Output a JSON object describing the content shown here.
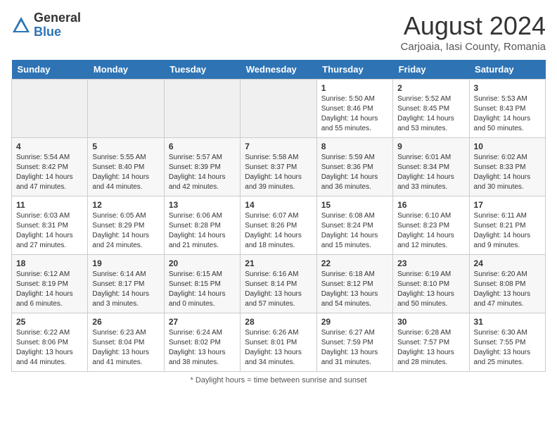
{
  "header": {
    "logo_line1": "General",
    "logo_line2": "Blue",
    "month_title": "August 2024",
    "subtitle": "Carjoaia, Iasi County, Romania"
  },
  "days_of_week": [
    "Sunday",
    "Monday",
    "Tuesday",
    "Wednesday",
    "Thursday",
    "Friday",
    "Saturday"
  ],
  "weeks": [
    [
      {
        "day": "",
        "info": ""
      },
      {
        "day": "",
        "info": ""
      },
      {
        "day": "",
        "info": ""
      },
      {
        "day": "",
        "info": ""
      },
      {
        "day": "1",
        "info": "Sunrise: 5:50 AM\nSunset: 8:46 PM\nDaylight: 14 hours\nand 55 minutes."
      },
      {
        "day": "2",
        "info": "Sunrise: 5:52 AM\nSunset: 8:45 PM\nDaylight: 14 hours\nand 53 minutes."
      },
      {
        "day": "3",
        "info": "Sunrise: 5:53 AM\nSunset: 8:43 PM\nDaylight: 14 hours\nand 50 minutes."
      }
    ],
    [
      {
        "day": "4",
        "info": "Sunrise: 5:54 AM\nSunset: 8:42 PM\nDaylight: 14 hours\nand 47 minutes."
      },
      {
        "day": "5",
        "info": "Sunrise: 5:55 AM\nSunset: 8:40 PM\nDaylight: 14 hours\nand 44 minutes."
      },
      {
        "day": "6",
        "info": "Sunrise: 5:57 AM\nSunset: 8:39 PM\nDaylight: 14 hours\nand 42 minutes."
      },
      {
        "day": "7",
        "info": "Sunrise: 5:58 AM\nSunset: 8:37 PM\nDaylight: 14 hours\nand 39 minutes."
      },
      {
        "day": "8",
        "info": "Sunrise: 5:59 AM\nSunset: 8:36 PM\nDaylight: 14 hours\nand 36 minutes."
      },
      {
        "day": "9",
        "info": "Sunrise: 6:01 AM\nSunset: 8:34 PM\nDaylight: 14 hours\nand 33 minutes."
      },
      {
        "day": "10",
        "info": "Sunrise: 6:02 AM\nSunset: 8:33 PM\nDaylight: 14 hours\nand 30 minutes."
      }
    ],
    [
      {
        "day": "11",
        "info": "Sunrise: 6:03 AM\nSunset: 8:31 PM\nDaylight: 14 hours\nand 27 minutes."
      },
      {
        "day": "12",
        "info": "Sunrise: 6:05 AM\nSunset: 8:29 PM\nDaylight: 14 hours\nand 24 minutes."
      },
      {
        "day": "13",
        "info": "Sunrise: 6:06 AM\nSunset: 8:28 PM\nDaylight: 14 hours\nand 21 minutes."
      },
      {
        "day": "14",
        "info": "Sunrise: 6:07 AM\nSunset: 8:26 PM\nDaylight: 14 hours\nand 18 minutes."
      },
      {
        "day": "15",
        "info": "Sunrise: 6:08 AM\nSunset: 8:24 PM\nDaylight: 14 hours\nand 15 minutes."
      },
      {
        "day": "16",
        "info": "Sunrise: 6:10 AM\nSunset: 8:23 PM\nDaylight: 14 hours\nand 12 minutes."
      },
      {
        "day": "17",
        "info": "Sunrise: 6:11 AM\nSunset: 8:21 PM\nDaylight: 14 hours\nand 9 minutes."
      }
    ],
    [
      {
        "day": "18",
        "info": "Sunrise: 6:12 AM\nSunset: 8:19 PM\nDaylight: 14 hours\nand 6 minutes."
      },
      {
        "day": "19",
        "info": "Sunrise: 6:14 AM\nSunset: 8:17 PM\nDaylight: 14 hours\nand 3 minutes."
      },
      {
        "day": "20",
        "info": "Sunrise: 6:15 AM\nSunset: 8:15 PM\nDaylight: 14 hours\nand 0 minutes."
      },
      {
        "day": "21",
        "info": "Sunrise: 6:16 AM\nSunset: 8:14 PM\nDaylight: 13 hours\nand 57 minutes."
      },
      {
        "day": "22",
        "info": "Sunrise: 6:18 AM\nSunset: 8:12 PM\nDaylight: 13 hours\nand 54 minutes."
      },
      {
        "day": "23",
        "info": "Sunrise: 6:19 AM\nSunset: 8:10 PM\nDaylight: 13 hours\nand 50 minutes."
      },
      {
        "day": "24",
        "info": "Sunrise: 6:20 AM\nSunset: 8:08 PM\nDaylight: 13 hours\nand 47 minutes."
      }
    ],
    [
      {
        "day": "25",
        "info": "Sunrise: 6:22 AM\nSunset: 8:06 PM\nDaylight: 13 hours\nand 44 minutes."
      },
      {
        "day": "26",
        "info": "Sunrise: 6:23 AM\nSunset: 8:04 PM\nDaylight: 13 hours\nand 41 minutes."
      },
      {
        "day": "27",
        "info": "Sunrise: 6:24 AM\nSunset: 8:02 PM\nDaylight: 13 hours\nand 38 minutes."
      },
      {
        "day": "28",
        "info": "Sunrise: 6:26 AM\nSunset: 8:01 PM\nDaylight: 13 hours\nand 34 minutes."
      },
      {
        "day": "29",
        "info": "Sunrise: 6:27 AM\nSunset: 7:59 PM\nDaylight: 13 hours\nand 31 minutes."
      },
      {
        "day": "30",
        "info": "Sunrise: 6:28 AM\nSunset: 7:57 PM\nDaylight: 13 hours\nand 28 minutes."
      },
      {
        "day": "31",
        "info": "Sunrise: 6:30 AM\nSunset: 7:55 PM\nDaylight: 13 hours\nand 25 minutes."
      }
    ]
  ],
  "footer_note": "Daylight hours"
}
